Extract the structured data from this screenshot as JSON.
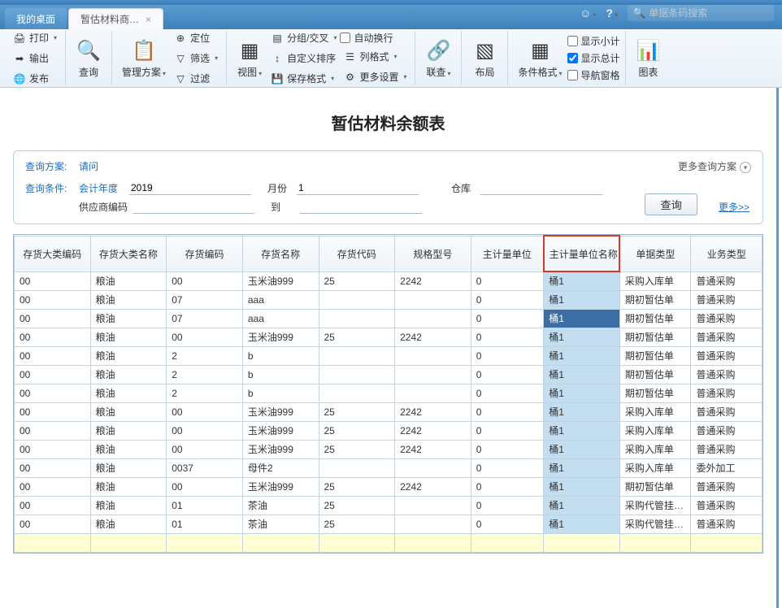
{
  "topbar": {
    "search_placeholder": "单据条码搜索"
  },
  "tabs": {
    "desktop": "我的桌面",
    "active": "暂估材料商…",
    "close": "×"
  },
  "ribbon": {
    "print": "打印",
    "export": "输出",
    "publish": "发布",
    "query": "查询",
    "manage_plan": "管理方案",
    "locate": "定位",
    "filter": "筛选",
    "filter2": "过滤",
    "view": "视图",
    "group": "分组/交叉",
    "custom_sort": "自定义排序",
    "save_format": "保存格式",
    "auto_wrap": "自动换行",
    "col_format": "列格式",
    "more_set": "更多设置",
    "relate": "联查",
    "layout": "布局",
    "cond_format": "条件格式",
    "show_sub": "显示小计",
    "show_total": "显示总计",
    "nav_pane": "导航窗格",
    "chart": "图表"
  },
  "report": {
    "title": "暂估材料余额表"
  },
  "query": {
    "plan_label": "查询方案:",
    "plan_value": "请问",
    "more_plan": "更多查询方案",
    "cond_label": "查询条件:",
    "fy_label": "会计年度",
    "fy_value": "2019",
    "month_label": "月份",
    "month_value": "1",
    "wh_label": "仓库",
    "wh_value": "",
    "supplier_label": "供应商编码",
    "supplier_value": "",
    "to_label": "到",
    "to_value": "",
    "btn": "查询",
    "more": "更多>>"
  },
  "columns": [
    "存货大类编码",
    "存货大类名称",
    "存货编码",
    "存货名称",
    "存货代码",
    "规格型号",
    "主计量单位",
    "主计量单位名称",
    "单据类型",
    "业务类型"
  ],
  "rows": [
    [
      "00",
      "粮油",
      "00",
      "玉米油999",
      "25",
      "2242",
      "0",
      "桶1",
      "采购入库单",
      "普通采购"
    ],
    [
      "00",
      "粮油",
      "07",
      "aaa",
      "",
      "",
      "0",
      "桶1",
      "期初暂估单",
      "普通采购"
    ],
    [
      "00",
      "粮油",
      "07",
      "aaa",
      "",
      "",
      "0",
      "桶1",
      "期初暂估单",
      "普通采购"
    ],
    [
      "00",
      "粮油",
      "00",
      "玉米油999",
      "25",
      "2242",
      "0",
      "桶1",
      "期初暂估单",
      "普通采购"
    ],
    [
      "00",
      "粮油",
      "2",
      "b",
      "",
      "",
      "0",
      "桶1",
      "期初暂估单",
      "普通采购"
    ],
    [
      "00",
      "粮油",
      "2",
      "b",
      "",
      "",
      "0",
      "桶1",
      "期初暂估单",
      "普通采购"
    ],
    [
      "00",
      "粮油",
      "2",
      "b",
      "",
      "",
      "0",
      "桶1",
      "期初暂估单",
      "普通采购"
    ],
    [
      "00",
      "粮油",
      "00",
      "玉米油999",
      "25",
      "2242",
      "0",
      "桶1",
      "采购入库单",
      "普通采购"
    ],
    [
      "00",
      "粮油",
      "00",
      "玉米油999",
      "25",
      "2242",
      "0",
      "桶1",
      "采购入库单",
      "普通采购"
    ],
    [
      "00",
      "粮油",
      "00",
      "玉米油999",
      "25",
      "2242",
      "0",
      "桶1",
      "采购入库单",
      "普通采购"
    ],
    [
      "00",
      "粮油",
      "0037",
      "母件2",
      "",
      "",
      "0",
      "桶1",
      "采购入库单",
      "委外加工"
    ],
    [
      "00",
      "粮油",
      "00",
      "玉米油999",
      "25",
      "2242",
      "0",
      "桶1",
      "期初暂估单",
      "普通采购"
    ],
    [
      "00",
      "粮油",
      "01",
      "茶油",
      "25",
      "",
      "0",
      "桶1",
      "采购代管挂…",
      "普通采购"
    ],
    [
      "00",
      "粮油",
      "01",
      "茶油",
      "25",
      "",
      "0",
      "桶1",
      "采购代管挂…",
      "普通采购"
    ],
    [
      "",
      "",
      "",
      "",
      "",
      "",
      "",
      "",
      "",
      ""
    ]
  ],
  "selected_row": 2
}
